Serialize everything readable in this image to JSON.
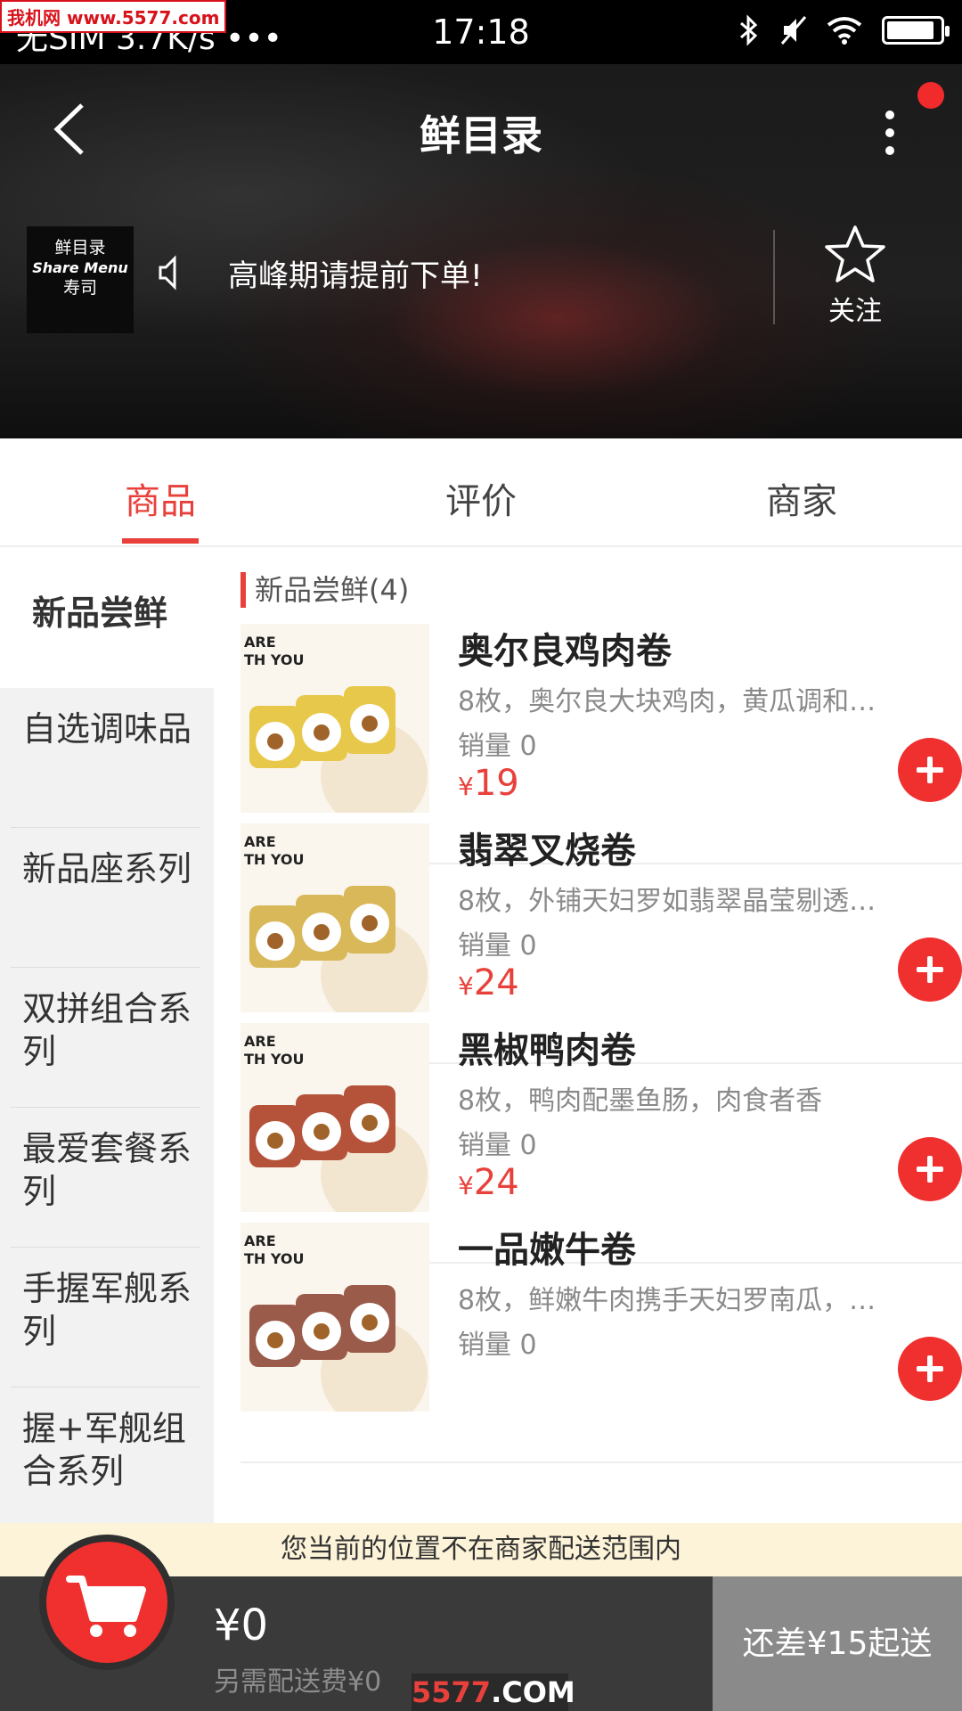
{
  "status_bar": {
    "carrier": "无SIM 3.7K/s •••",
    "time": "17:18",
    "watermark": "我机网 www.5577.com",
    "battery_level": 0.9
  },
  "header": {
    "title": "鲜目录",
    "logo_text_top": "鲜目录",
    "logo_text_en": "Share Menu",
    "logo_text_bottom": "寿司",
    "notice": "高峰期请提前下单!",
    "follow_label": "关注"
  },
  "tabs": [
    {
      "label": "商品",
      "active": true
    },
    {
      "label": "评价",
      "active": false
    },
    {
      "label": "商家",
      "active": false
    }
  ],
  "categories": [
    {
      "label": "新品尝鲜",
      "active": true
    },
    {
      "label": "自选调味品",
      "active": false
    },
    {
      "label": "新品座系列",
      "active": false
    },
    {
      "label": "双拼组合系列",
      "active": false
    },
    {
      "label": "最爱套餐系列",
      "active": false
    },
    {
      "label": "手握军舰系列",
      "active": false
    },
    {
      "label": "握+军舰组合系列",
      "active": false
    }
  ],
  "section": {
    "title": "新品尝鲜(4)"
  },
  "products": [
    {
      "name": "奥尔良鸡肉卷",
      "desc": "8枚，奥尔良大块鸡肉，黄瓜调和…",
      "sales": "销量 0",
      "currency": "¥",
      "price": "19",
      "image_text": "ARE\nTH YOU",
      "color": "#e8c84a"
    },
    {
      "name": "翡翠叉烧卷",
      "desc": "8枚，外铺天妇罗如翡翠晶莹剔透…",
      "sales": "销量 0",
      "currency": "¥",
      "price": "24",
      "image_text": "ARE\nTH YOU",
      "color": "#d9b85a"
    },
    {
      "name": "黑椒鸭肉卷",
      "desc": "8枚，鸭肉配墨鱼肠，肉食者香",
      "sales": "销量 0",
      "currency": "¥",
      "price": "24",
      "image_text": "ARE\nTH YOU",
      "color": "#b5533a"
    },
    {
      "name": "一品嫩牛卷",
      "desc": "8枚，鲜嫩牛肉携手天妇罗南瓜，…",
      "sales": "销量 0",
      "currency": "¥",
      "price": "",
      "image_text": "ARE\nTH YOU",
      "color": "#9a5b4a"
    }
  ],
  "delivery_notice": "您当前的位置不在商家配送范围内",
  "cart": {
    "total": "¥0",
    "fee": "另需配送费¥0",
    "checkout": "还差¥15起送"
  },
  "footer_watermark": {
    "part1": "5577",
    "part2": ".COM"
  },
  "colors": {
    "accent": "#e8413b",
    "add_button": "#f0302f",
    "notice_bg": "#fcf3d8"
  }
}
